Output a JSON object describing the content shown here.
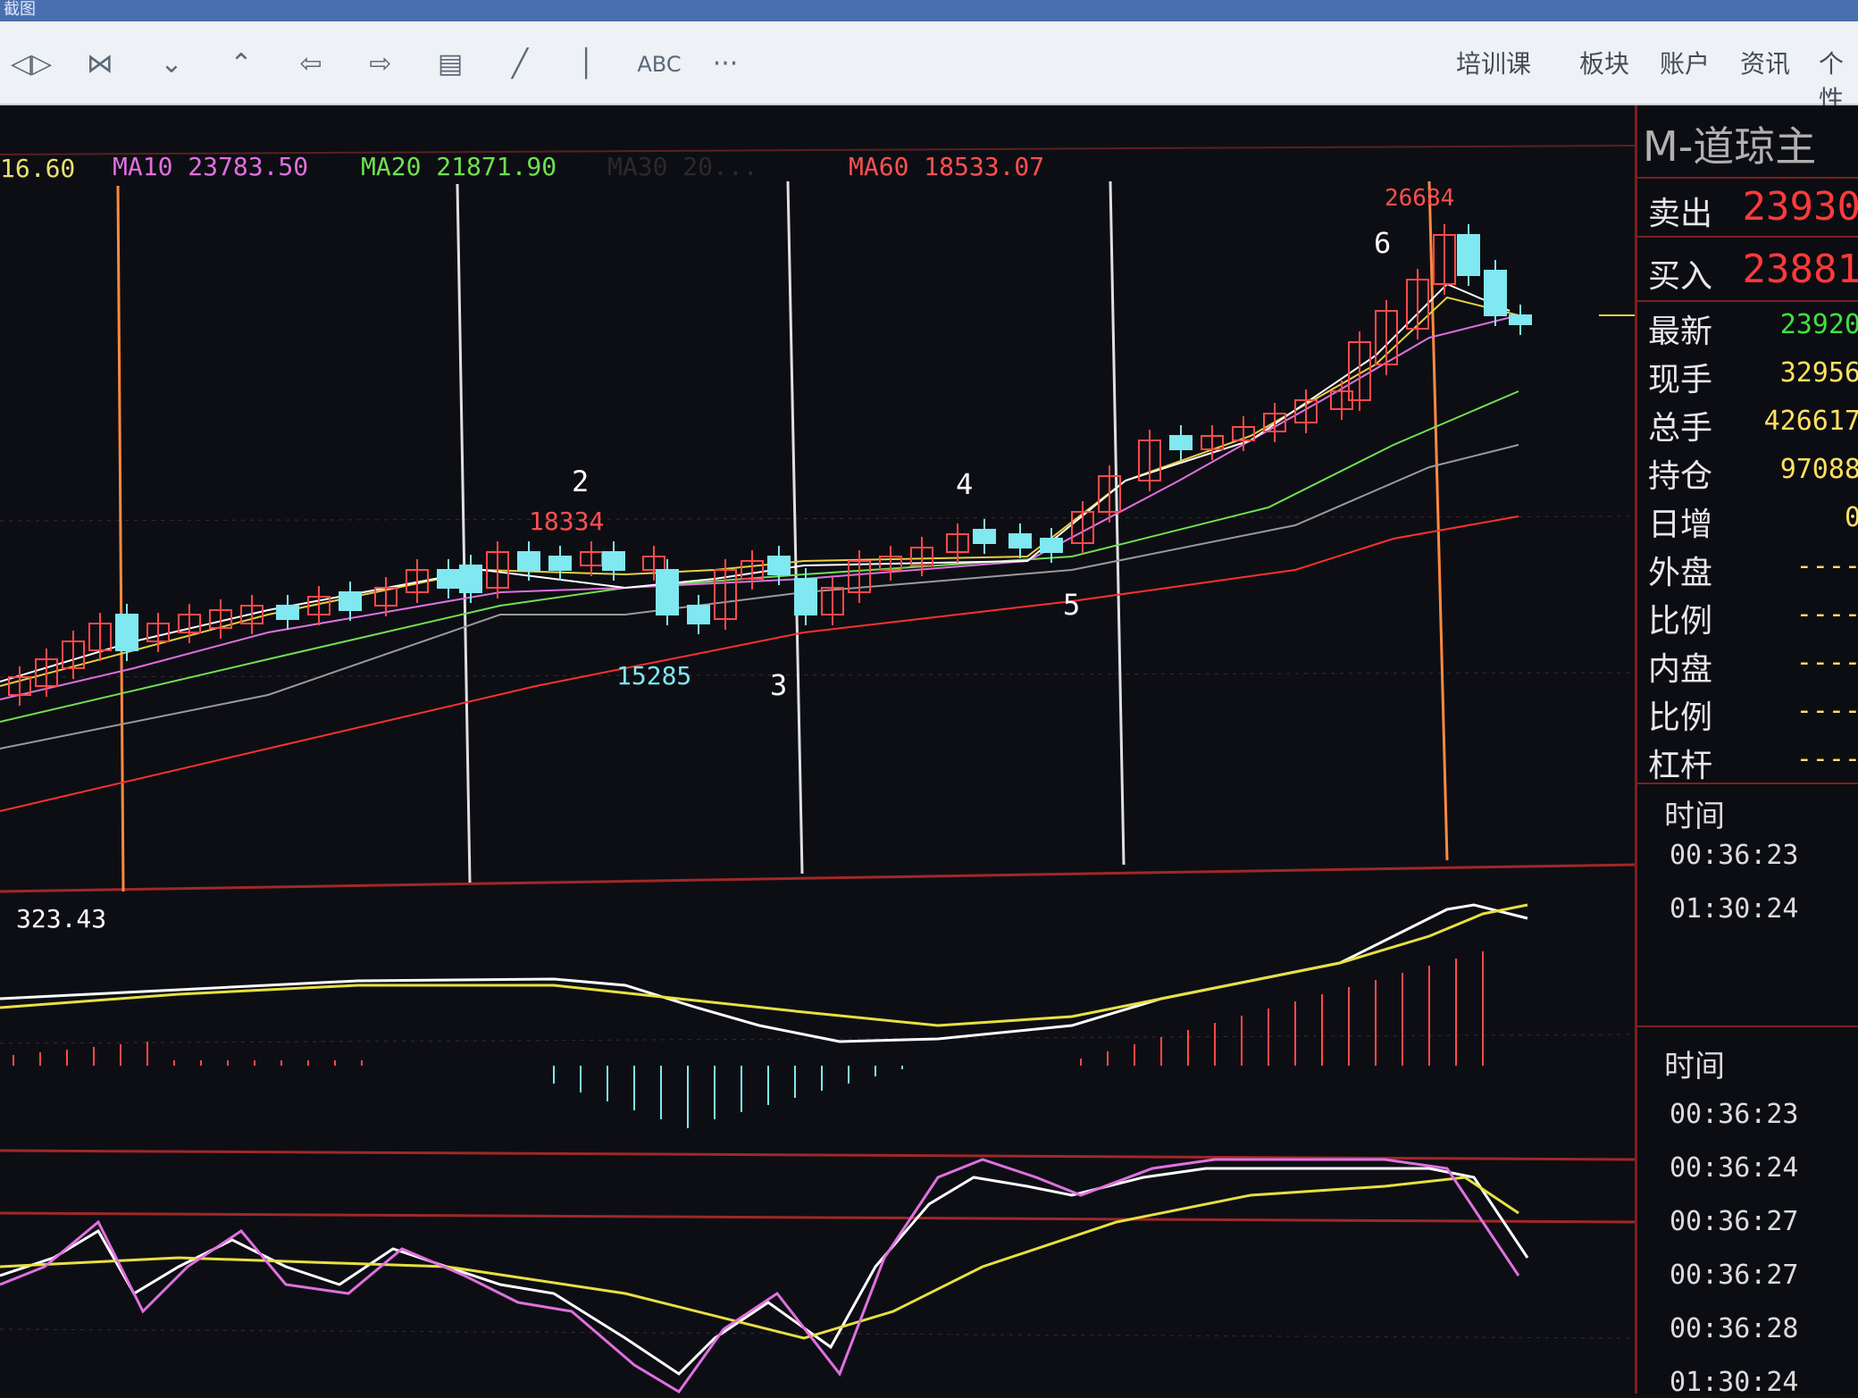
{
  "window": {
    "title_fragment": "截图"
  },
  "toolbar": {
    "icons": [
      "zoom-in-out-icon",
      "fit-icon",
      "scroll-down-icon",
      "scroll-up-icon",
      "left-arrow-icon",
      "right-arrow-icon",
      "layout-grid-icon",
      "draw-line-icon",
      "vertical-line-icon",
      "text-abc-icon",
      "more-icon"
    ],
    "abc_label": "ABC",
    "more_label": "···",
    "menu": [
      "培训课",
      "板块",
      "账户",
      "资讯",
      "个性"
    ]
  },
  "indicators": {
    "ma5": "16.60",
    "ma10": "MA10 23783.50",
    "ma20": "MA20 21871.90",
    "ma30": "MA30 20...",
    "ma60": "MA60 18533.07"
  },
  "annotations": {
    "peak_high": "26684",
    "high_2": "18334",
    "low_1": "15285",
    "wave_labels": [
      "2",
      "3",
      "4",
      "5",
      "6"
    ]
  },
  "macd_value": "323.43",
  "side_panel": {
    "title": "M-道琼主",
    "sell_label": "卖出",
    "sell_value": "23930",
    "buy_label": "买入",
    "buy_value": "23881",
    "rows": [
      {
        "label": "最新",
        "value": "23920"
      },
      {
        "label": "现手",
        "value": "32956"
      },
      {
        "label": "总手",
        "value": "426617"
      },
      {
        "label": "持仓",
        "value": "97088"
      },
      {
        "label": "日增",
        "value": "0"
      },
      {
        "label": "外盘",
        "value": "----"
      },
      {
        "label": "比例",
        "value": "----"
      },
      {
        "label": "内盘",
        "value": "----"
      },
      {
        "label": "比例",
        "value": "----"
      },
      {
        "label": "杠杆",
        "value": "----"
      }
    ],
    "time_header_1": "时间",
    "times_1": [
      "00:36:23",
      "01:30:24"
    ],
    "time_header_2": "时间",
    "times_2": [
      "00:36:23",
      "00:36:24",
      "00:36:27",
      "00:36:27",
      "00:36:28",
      "01:30:24"
    ]
  },
  "colors": {
    "up": "#ff4a4a",
    "down": "#7fe8f0",
    "ma5": "#ffffff",
    "ma10": "#e070e0",
    "ma20": "#70e050",
    "ma30": "#9a9a9a",
    "ma60": "#ff3030"
  }
}
